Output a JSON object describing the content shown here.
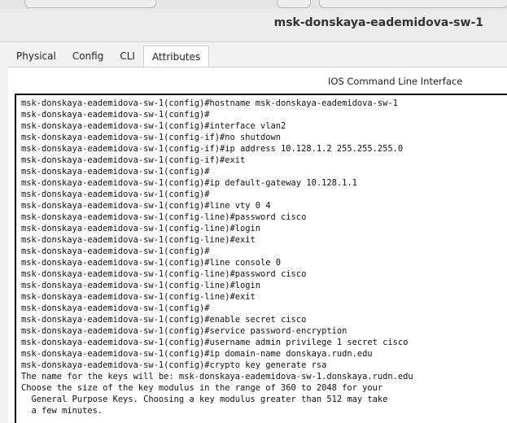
{
  "window": {
    "title": "msk-donskaya-eademidova-sw-1"
  },
  "tabs": [
    {
      "label": "Physical",
      "active": false
    },
    {
      "label": "Config",
      "active": false
    },
    {
      "label": "CLI",
      "active": true
    },
    {
      "label": "Attributes",
      "active": false
    }
  ],
  "cli": {
    "header": "IOS Command Line Interface",
    "lines": [
      "msk-donskaya-eademidova-sw-1(config)#hostname msk-donskaya-eademidova-sw-1",
      "msk-donskaya-eademidova-sw-1(config)#",
      "msk-donskaya-eademidova-sw-1(config)#interface vlan2",
      "msk-donskaya-eademidova-sw-1(config-if)#no shutdown",
      "msk-donskaya-eademidova-sw-1(config-if)#ip address 10.128.1.2 255.255.255.0",
      "msk-donskaya-eademidova-sw-1(config-if)#exit",
      "msk-donskaya-eademidova-sw-1(config)#",
      "msk-donskaya-eademidova-sw-1(config)#ip default-gateway 10.128.1.1",
      "msk-donskaya-eademidova-sw-1(config)#",
      "msk-donskaya-eademidova-sw-1(config)#line vty 0 4",
      "msk-donskaya-eademidova-sw-1(config-line)#password cisco",
      "msk-donskaya-eademidova-sw-1(config-line)#login",
      "msk-donskaya-eademidova-sw-1(config-line)#exit",
      "msk-donskaya-eademidova-sw-1(config)#",
      "msk-donskaya-eademidova-sw-1(config)#line console 0",
      "msk-donskaya-eademidova-sw-1(config-line)#password cisco",
      "msk-donskaya-eademidova-sw-1(config-line)#login",
      "msk-donskaya-eademidova-sw-1(config-line)#exit",
      "msk-donskaya-eademidova-sw-1(config)#",
      "msk-donskaya-eademidova-sw-1(config)#enable secret cisco",
      "msk-donskaya-eademidova-sw-1(config)#service password-encryption",
      "msk-donskaya-eademidova-sw-1(config)#username admin privilege 1 secret cisco",
      "msk-donskaya-eademidova-sw-1(config)#ip domain-name donskaya.rudn.edu",
      "msk-donskaya-eademidova-sw-1(config)#crypto key generate rsa",
      "The name for the keys will be: msk-donskaya-eademidova-sw-1.donskaya.rudn.edu",
      "Choose the size of the key modulus in the range of 360 to 2048 for your",
      "  General Purpose Keys. Choosing a key modulus greater than 512 may take",
      "  a few minutes."
    ]
  }
}
